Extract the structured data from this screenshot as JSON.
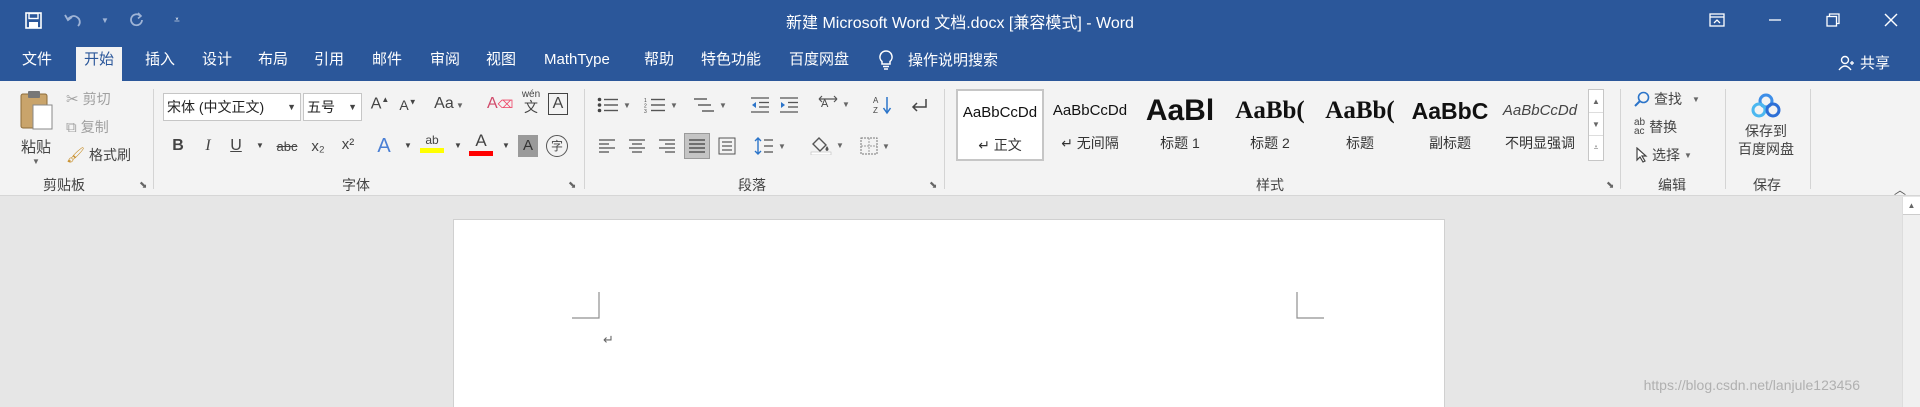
{
  "window": {
    "title": "新建 Microsoft Word 文档.docx [兼容模式]  -  Word"
  },
  "qat": {
    "save_icon": "save-icon",
    "undo_icon": "undo-icon",
    "redo_icon": "redo-icon",
    "customize_icon": "customize-qat-icon"
  },
  "tabs": [
    {
      "label": "文件"
    },
    {
      "label": "开始"
    },
    {
      "label": "插入"
    },
    {
      "label": "设计"
    },
    {
      "label": "布局"
    },
    {
      "label": "引用"
    },
    {
      "label": "邮件"
    },
    {
      "label": "审阅"
    },
    {
      "label": "视图"
    },
    {
      "label": "MathType"
    },
    {
      "label": "帮助"
    },
    {
      "label": "特色功能"
    },
    {
      "label": "百度网盘"
    }
  ],
  "tell_me": "操作说明搜索",
  "share": "共享",
  "clipboard": {
    "paste": "粘贴",
    "cut": "剪切",
    "copy": "复制",
    "format_painter": "格式刷",
    "group_label": "剪贴板"
  },
  "font": {
    "font_name": "宋体 (中文正文)",
    "font_size": "五号",
    "change_case": "Aa",
    "phonetic": "wén",
    "char_border": "A",
    "bold": "B",
    "italic": "I",
    "underline": "U",
    "strike": "abc",
    "subscript": "x₂",
    "superscript": "x²",
    "text_effect": "A",
    "highlight": "ab",
    "font_color": "A",
    "shading": "A",
    "enclose": "字",
    "group_label": "字体"
  },
  "paragraph": {
    "group_label": "段落"
  },
  "styles": {
    "group_label": "样式",
    "items": [
      {
        "sample": "AaBbCcDd",
        "name": "↵ 正文"
      },
      {
        "sample": "AaBbCcDd",
        "name": "↵ 无间隔"
      },
      {
        "sample": "AaBl",
        "name": "标题 1"
      },
      {
        "sample": "AaBb(",
        "name": "标题 2"
      },
      {
        "sample": "AaBb(",
        "name": "标题"
      },
      {
        "sample": "AaBbC",
        "name": "副标题"
      },
      {
        "sample": "AaBbCcDd",
        "name": "不明显强调"
      }
    ]
  },
  "editing": {
    "find": "查找",
    "replace": "替换",
    "select": "选择",
    "group_label": "编辑"
  },
  "save": {
    "save_to": "保存到",
    "baidu": "百度网盘",
    "group_label": "保存"
  },
  "document": {
    "paragraph_mark": "↵"
  },
  "watermark": "https://blog.csdn.net/lanjule123456",
  "colors": {
    "brand": "#2b579a",
    "ribbon": "#f3f3f3",
    "canvas": "#e6e6e6",
    "highlight_yellow": "#ffff00",
    "font_red": "#ff0000"
  }
}
